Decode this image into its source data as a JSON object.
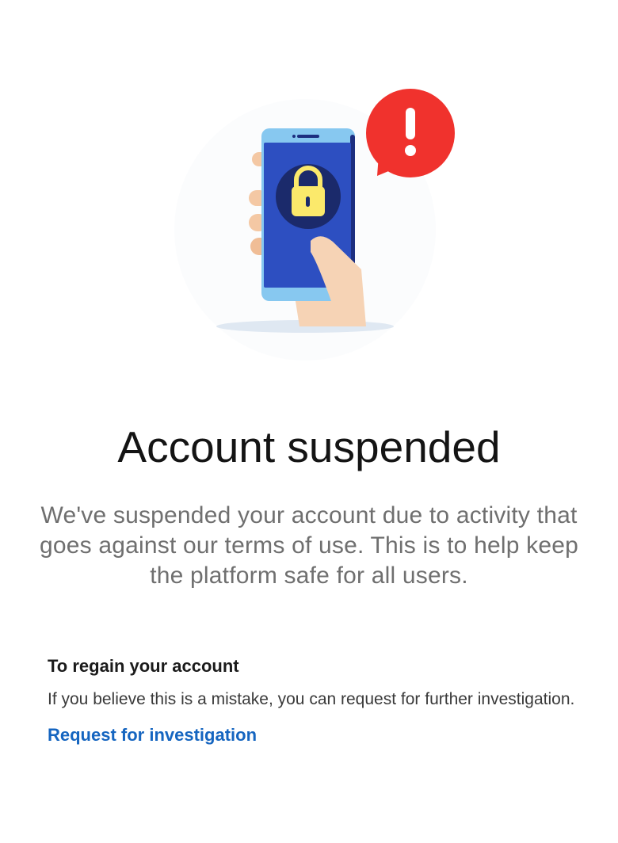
{
  "header": {
    "illustration_icon": "locked-phone-alert-icon"
  },
  "main": {
    "title": "Account suspended",
    "description": "We've suspended your account due to activity that goes against our terms of use. This is to help keep the platform safe for all users."
  },
  "regain": {
    "heading": "To regain your account",
    "text": "If you believe this is a mistake, you can request for further investigation.",
    "link_label": "Request for investigation"
  },
  "colors": {
    "alert_red": "#f0322d",
    "phone_blue": "#2d4fc1",
    "lock_yellow": "#fbe96b",
    "link_blue": "#1565c0"
  }
}
